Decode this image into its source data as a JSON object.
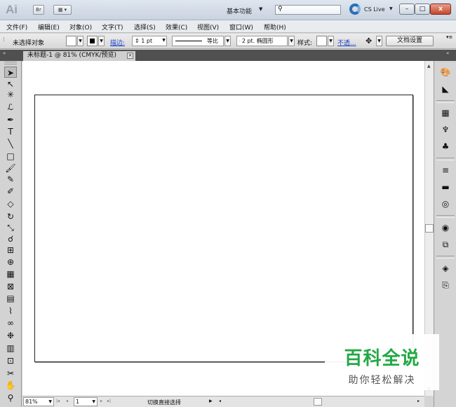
{
  "app": {
    "logo": "Ai",
    "bridge_label": "Br",
    "workspace": "基本功能",
    "search_placeholder": "",
    "cslive": "CS Live",
    "window_buttons": [
      "–",
      "□",
      "x"
    ]
  },
  "menubar": {
    "items": [
      "文件(F)",
      "编辑(E)",
      "对象(O)",
      "文字(T)",
      "选择(S)",
      "效果(C)",
      "视图(V)",
      "窗口(W)",
      "帮助(H)"
    ]
  },
  "controlbar": {
    "selection": "未选择对象",
    "stroke_label": "描边:",
    "stroke_weight": "1 pt",
    "stroke_profile": "等比",
    "brush": "2 pt. 椭圆形",
    "style_label": "样式:",
    "opacity_label": "不透...",
    "doc_settings": "文档设置"
  },
  "document": {
    "tab_title": "未标题-1 @ 81% (CMYK/预览)",
    "tab_close": "×"
  },
  "statusbar": {
    "zoom": "81%",
    "page": "1",
    "status_text": "切换直接选择"
  },
  "tools": [
    {
      "name": "selection-tool-icon",
      "glyph": "➤",
      "active": true
    },
    {
      "name": "direct-selection-tool-icon",
      "glyph": "↖"
    },
    {
      "name": "magic-wand-tool-icon",
      "glyph": "✳"
    },
    {
      "name": "lasso-tool-icon",
      "glyph": "ℒ"
    },
    {
      "name": "pen-tool-icon",
      "glyph": "✒"
    },
    {
      "name": "type-tool-icon",
      "glyph": "T"
    },
    {
      "name": "line-tool-icon",
      "glyph": "╲"
    },
    {
      "name": "rectangle-tool-icon",
      "glyph": "□"
    },
    {
      "name": "paintbrush-tool-icon",
      "glyph": "🖌"
    },
    {
      "name": "pencil-tool-icon",
      "glyph": "✎"
    },
    {
      "name": "blob-brush-tool-icon",
      "glyph": "✐"
    },
    {
      "name": "eraser-tool-icon",
      "glyph": "◇"
    },
    {
      "name": "rotate-tool-icon",
      "glyph": "↻"
    },
    {
      "name": "scale-tool-icon",
      "glyph": "⤡"
    },
    {
      "name": "warp-tool-icon",
      "glyph": "☌"
    },
    {
      "name": "free-transform-tool-icon",
      "glyph": "⊞"
    },
    {
      "name": "shape-builder-tool-icon",
      "glyph": "⊕"
    },
    {
      "name": "perspective-grid-tool-icon",
      "glyph": "▦"
    },
    {
      "name": "mesh-tool-icon",
      "glyph": "⊠"
    },
    {
      "name": "gradient-tool-icon",
      "glyph": "▤"
    },
    {
      "name": "eyedropper-tool-icon",
      "glyph": "⌇"
    },
    {
      "name": "blend-tool-icon",
      "glyph": "∞"
    },
    {
      "name": "symbol-sprayer-tool-icon",
      "glyph": "❉"
    },
    {
      "name": "column-graph-tool-icon",
      "glyph": "▥"
    },
    {
      "name": "artboard-tool-icon",
      "glyph": "⊡"
    },
    {
      "name": "slice-tool-icon",
      "glyph": "✂"
    },
    {
      "name": "hand-tool-icon",
      "glyph": "✋"
    },
    {
      "name": "zoom-tool-icon",
      "glyph": "⚲"
    }
  ],
  "right_panels": [
    {
      "name": "color-panel-icon",
      "glyph": "🎨"
    },
    {
      "name": "color-guide-panel-icon",
      "glyph": "◣"
    },
    {
      "name": "swatches-panel-icon",
      "glyph": "▦"
    },
    {
      "name": "brushes-panel-icon",
      "glyph": "♆"
    },
    {
      "name": "symbols-panel-icon",
      "glyph": "♣"
    },
    {
      "name": "stroke-panel-icon",
      "glyph": "≡"
    },
    {
      "name": "gradient-panel-icon",
      "glyph": "▬"
    },
    {
      "name": "transparency-panel-icon",
      "glyph": "◎"
    },
    {
      "name": "appearance-panel-icon",
      "glyph": "◉"
    },
    {
      "name": "graphic-styles-panel-icon",
      "glyph": "⧉"
    },
    {
      "name": "layers-panel-icon",
      "glyph": "◈"
    },
    {
      "name": "artboards-panel-icon",
      "glyph": "⎘"
    }
  ],
  "watermark": {
    "title": "百科全说",
    "subtitle": "助你轻松解决"
  }
}
